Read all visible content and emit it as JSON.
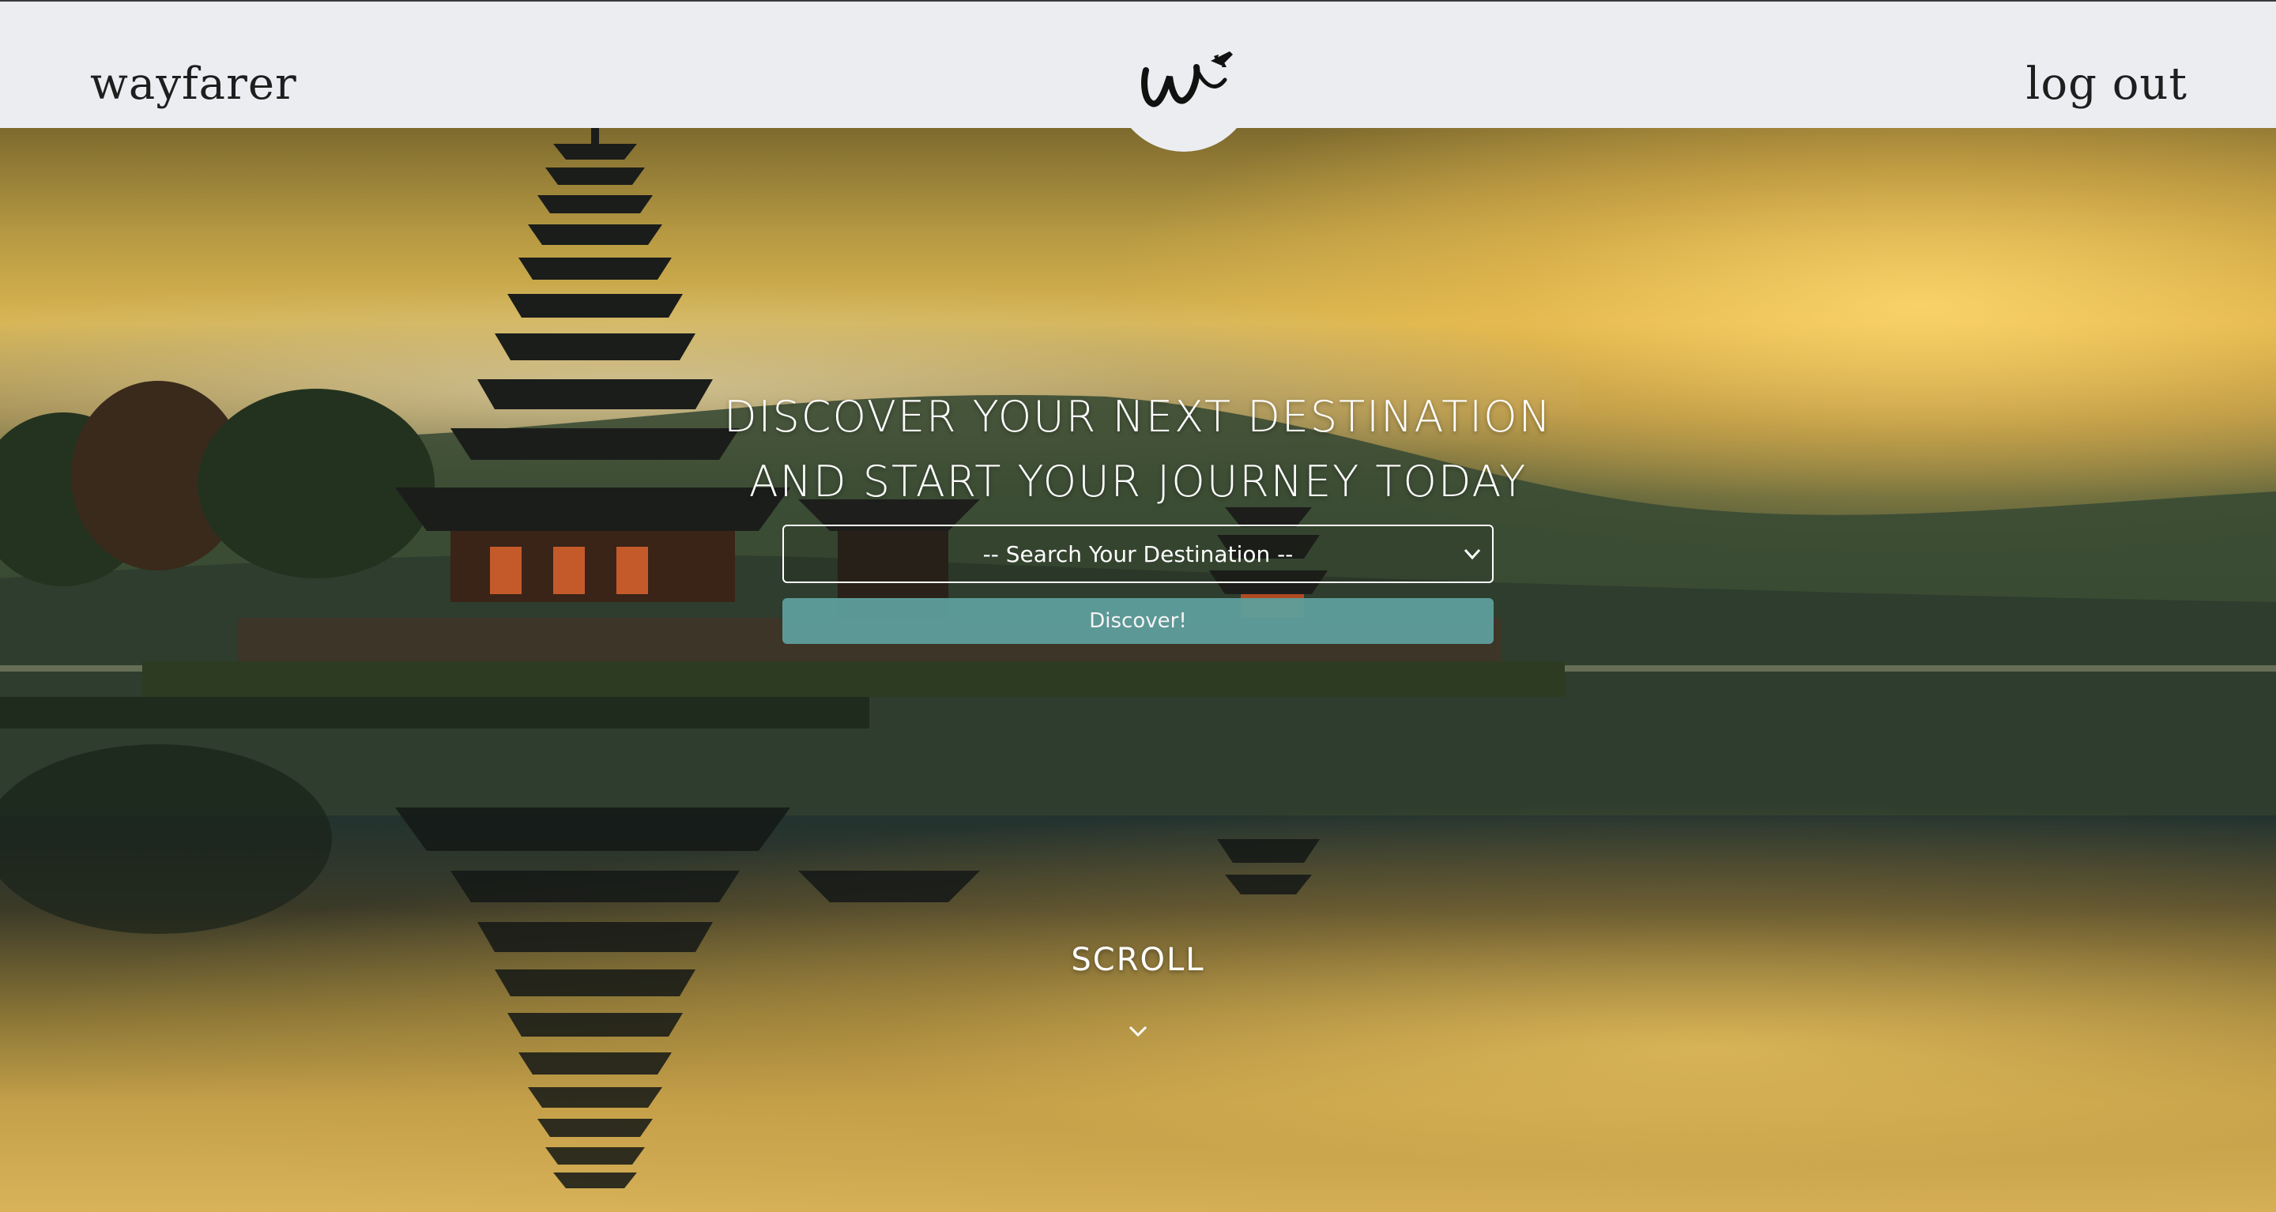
{
  "header": {
    "brand": "wayfarer",
    "logout_label": "log out",
    "logo_icon": "wayfarer-signature-logo"
  },
  "hero": {
    "headline_line1": "DISCOVER YOUR NEXT DESTINATION",
    "headline_line2": "AND START YOUR JOURNEY TODAY",
    "search_select": {
      "selected": "-- Search Your Destination --"
    },
    "discover_label": "Discover!",
    "scroll_label": "SCROLL",
    "scroll_icon": "chevron-down-icon",
    "background_icon": "lake-temple-photo"
  },
  "colors": {
    "navbar_bg": "#ecedf1",
    "button_teal": "#5e9e9c",
    "text_light": "#ffffff",
    "text_dark": "#1e1e1e"
  }
}
